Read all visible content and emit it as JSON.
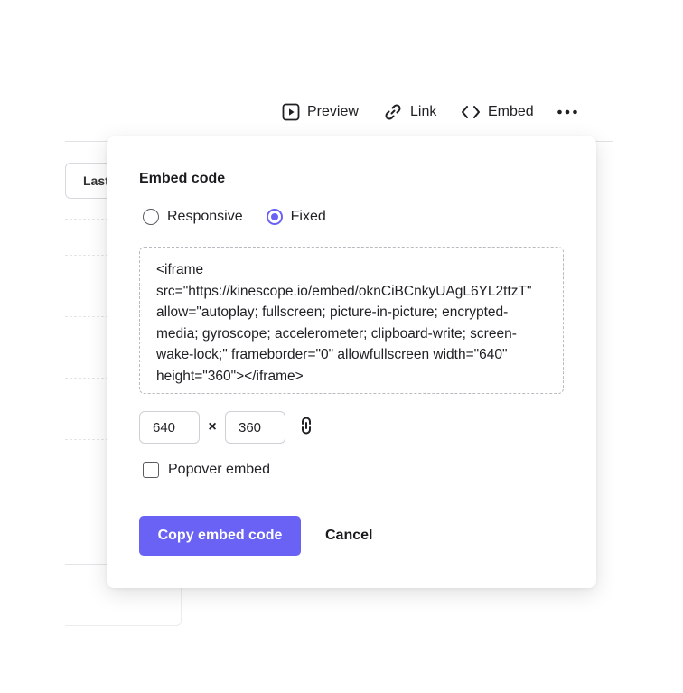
{
  "toolbar": {
    "preview_label": "Preview",
    "link_label": "Link",
    "embed_label": "Embed",
    "preview_icon": "play-square-icon",
    "link_icon": "link-icon",
    "embed_icon": "code-brackets-icon",
    "more_icon": "more-dots-icon"
  },
  "background": {
    "filter_label": "Last"
  },
  "modal": {
    "title": "Embed code",
    "options": [
      {
        "label": "Responsive",
        "selected": false
      },
      {
        "label": "Fixed",
        "selected": true
      }
    ],
    "code": "<iframe src=\"https://kinescope.io/embed/oknCiBCnkyUAgL6YL2ttzT\" allow=\"autoplay; fullscreen; picture-in-picture; encrypted-media; gyroscope; accelerometer; clipboard-write; screen-wake-lock;\" frameborder=\"0\" allowfullscreen width=\"640\" height=\"360\"></iframe>",
    "width_value": "640",
    "times_symbol": "×",
    "height_value": "360",
    "aspect_lock_icon": "chain-link-icon",
    "popover_label": "Popover embed",
    "popover_checked": false,
    "copy_label": "Copy embed code",
    "cancel_label": "Cancel"
  },
  "colors": {
    "accent": "#6a62f4",
    "text": "#1f1f24",
    "border": "#cfcfd5"
  }
}
